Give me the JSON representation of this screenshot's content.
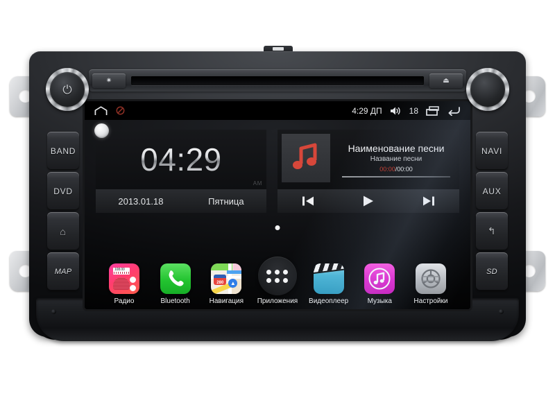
{
  "device": {
    "name": "car-head-unit",
    "power_button_glyph": "⏻",
    "top_panel": {
      "brightness_label": "✷",
      "eject_label": "⏏",
      "slot_label": "disc-slot"
    },
    "left_keys": [
      {
        "label": "BAND",
        "name": "band-key"
      },
      {
        "label": "DVD",
        "name": "dvd-key"
      },
      {
        "label": "⌂",
        "name": "home-key"
      },
      {
        "label": "MAP",
        "name": "map-key"
      }
    ],
    "right_keys": [
      {
        "label": "NAVI",
        "name": "navi-key"
      },
      {
        "label": "AUX",
        "name": "aux-key"
      },
      {
        "label": "↰",
        "name": "return-key"
      },
      {
        "label": "SD",
        "name": "sd-key"
      }
    ]
  },
  "status_bar": {
    "home_icon": "home-icon",
    "mute_icon": "no-signal-icon",
    "time": "4:29 ДП",
    "volume_icon": "volume-icon",
    "volume_value": "18",
    "recents_icon": "recents-icon",
    "back_icon": "back-icon"
  },
  "clock_widget": {
    "time": "04:29",
    "ampm": "AM",
    "date": "2013.01.18",
    "weekday": "Пятница"
  },
  "music_widget": {
    "album_art_icon": "music-note-icon",
    "track_title": "Наименование песни",
    "track_subtitle": "Название песни",
    "time_elapsed": "00:00",
    "time_separator": "/",
    "time_total": "00:00",
    "elapsed_color": "#c8392b",
    "controls": {
      "previous": "⏮",
      "play": "▶",
      "next": "⏭"
    }
  },
  "home_screen": {
    "page_indicator_dots": 1,
    "apps": [
      {
        "label": "Радио",
        "icon": "radio-icon"
      },
      {
        "label": "Bluetooth",
        "icon": "phone-icon"
      },
      {
        "label": "Навигация",
        "icon": "maps-icon"
      },
      {
        "label": "Приложения",
        "icon": "app-drawer-icon"
      },
      {
        "label": "Видеоплеер",
        "icon": "clapperboard-icon"
      },
      {
        "label": "Музыка",
        "icon": "music-note-icon"
      },
      {
        "label": "Настройки",
        "icon": "gear-icon"
      }
    ],
    "nav_shield_number": "280"
  },
  "colors": {
    "accent_red": "#c8392b",
    "screen_black": "#000000",
    "chassis_dark": "#17181b",
    "bracket_silver": "#cfd1d4"
  }
}
